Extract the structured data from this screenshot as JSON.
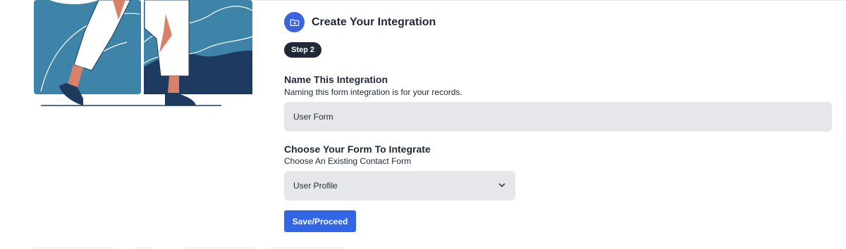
{
  "header": {
    "title": "Create Your Integration",
    "icon": "folder-plus-icon"
  },
  "step": {
    "label": "Step 2"
  },
  "name_section": {
    "title": "Name This Integration",
    "help": "Naming this form integration is for your records.",
    "input_value": "User Form"
  },
  "form_section": {
    "title": "Choose Your Form To Integrate",
    "help": "Choose An Existing Contact Form",
    "selected": "User Profile"
  },
  "actions": {
    "save_label": "Save/Proceed"
  },
  "colors": {
    "accent": "#3366e6",
    "badge": "#1f2937",
    "input_bg": "#e5e7eb",
    "illustration_blue": "#3d84a8",
    "illustration_navy": "#1e3a5f",
    "skin": "#d9806a"
  }
}
